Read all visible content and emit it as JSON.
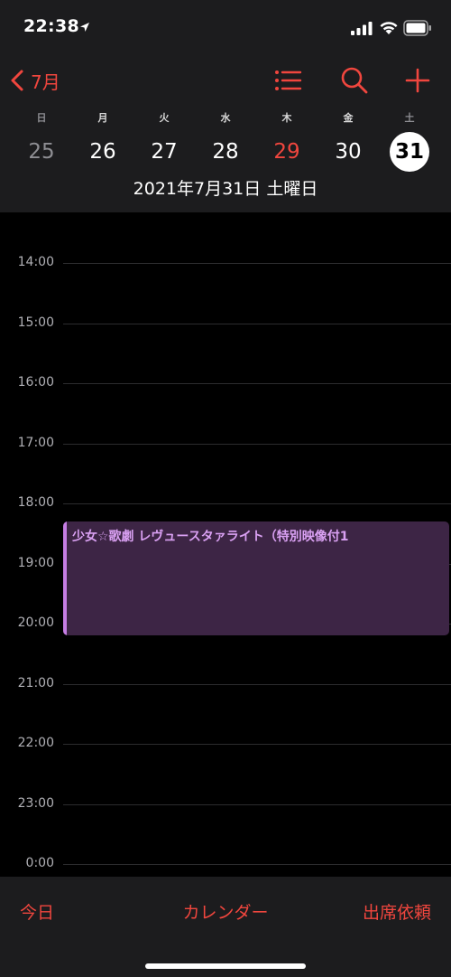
{
  "status_bar": {
    "time": "22:38",
    "icons": [
      "location-arrow-icon",
      "cellular-signal-icon",
      "wifi-icon",
      "battery-icon"
    ]
  },
  "header": {
    "back_label": "7月",
    "weekdays": [
      "日",
      "月",
      "火",
      "水",
      "木",
      "金",
      "土"
    ],
    "dates": [
      "25",
      "26",
      "27",
      "28",
      "29",
      "30",
      "31"
    ],
    "today_index": 4,
    "selected_index": 6,
    "full_date": "2021年7月31日 土曜日",
    "icons": [
      "chevron-left-icon",
      "list-icon",
      "search-icon",
      "plus-icon"
    ]
  },
  "timeline": {
    "hours": [
      "14:00",
      "15:00",
      "16:00",
      "17:00",
      "18:00",
      "19:00",
      "20:00",
      "21:00",
      "22:00",
      "23:00",
      "0:00"
    ]
  },
  "event": {
    "title": "少女☆歌劇 レヴュースタァライト（特別映像付1",
    "start_hour": 18.3,
    "end_hour": 20.2,
    "color": "#c57de3"
  },
  "toolbar": {
    "today_label": "今日",
    "calendars_label": "カレンダー",
    "inbox_label": "出席依頼"
  },
  "colors": {
    "accent": "#f0463e",
    "background": "#000000",
    "bar_background": "#1c1c1e"
  }
}
